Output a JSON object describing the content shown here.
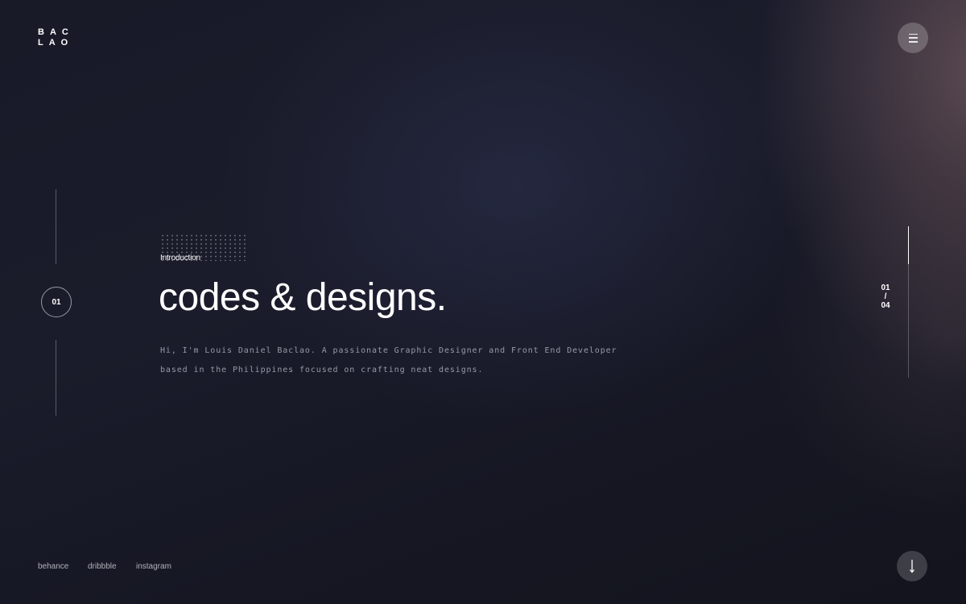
{
  "header": {
    "logo_line1": "BAC",
    "logo_line2": "LAO",
    "menu_icon": "hamburger-icon"
  },
  "side": {
    "slide_number": "01"
  },
  "hero": {
    "eyebrow": "Introduction",
    "title": "codes & designs.",
    "description_line1": "Hi, I'm Louis Daniel Baclao. A passionate Graphic Designer and Front End Developer",
    "description_line2": "based in the Philippines focused on crafting neat designs."
  },
  "pager": {
    "current": "01",
    "separator": "/",
    "total": "04",
    "progress_fraction": 0.25
  },
  "footer": {
    "social_links": [
      "behance",
      "dribbble",
      "instagram"
    ],
    "scroll_icon": "arrow-down-icon"
  },
  "colors": {
    "background": "#181a28",
    "text": "#ffffff",
    "accent_glow": "#6e565c"
  }
}
